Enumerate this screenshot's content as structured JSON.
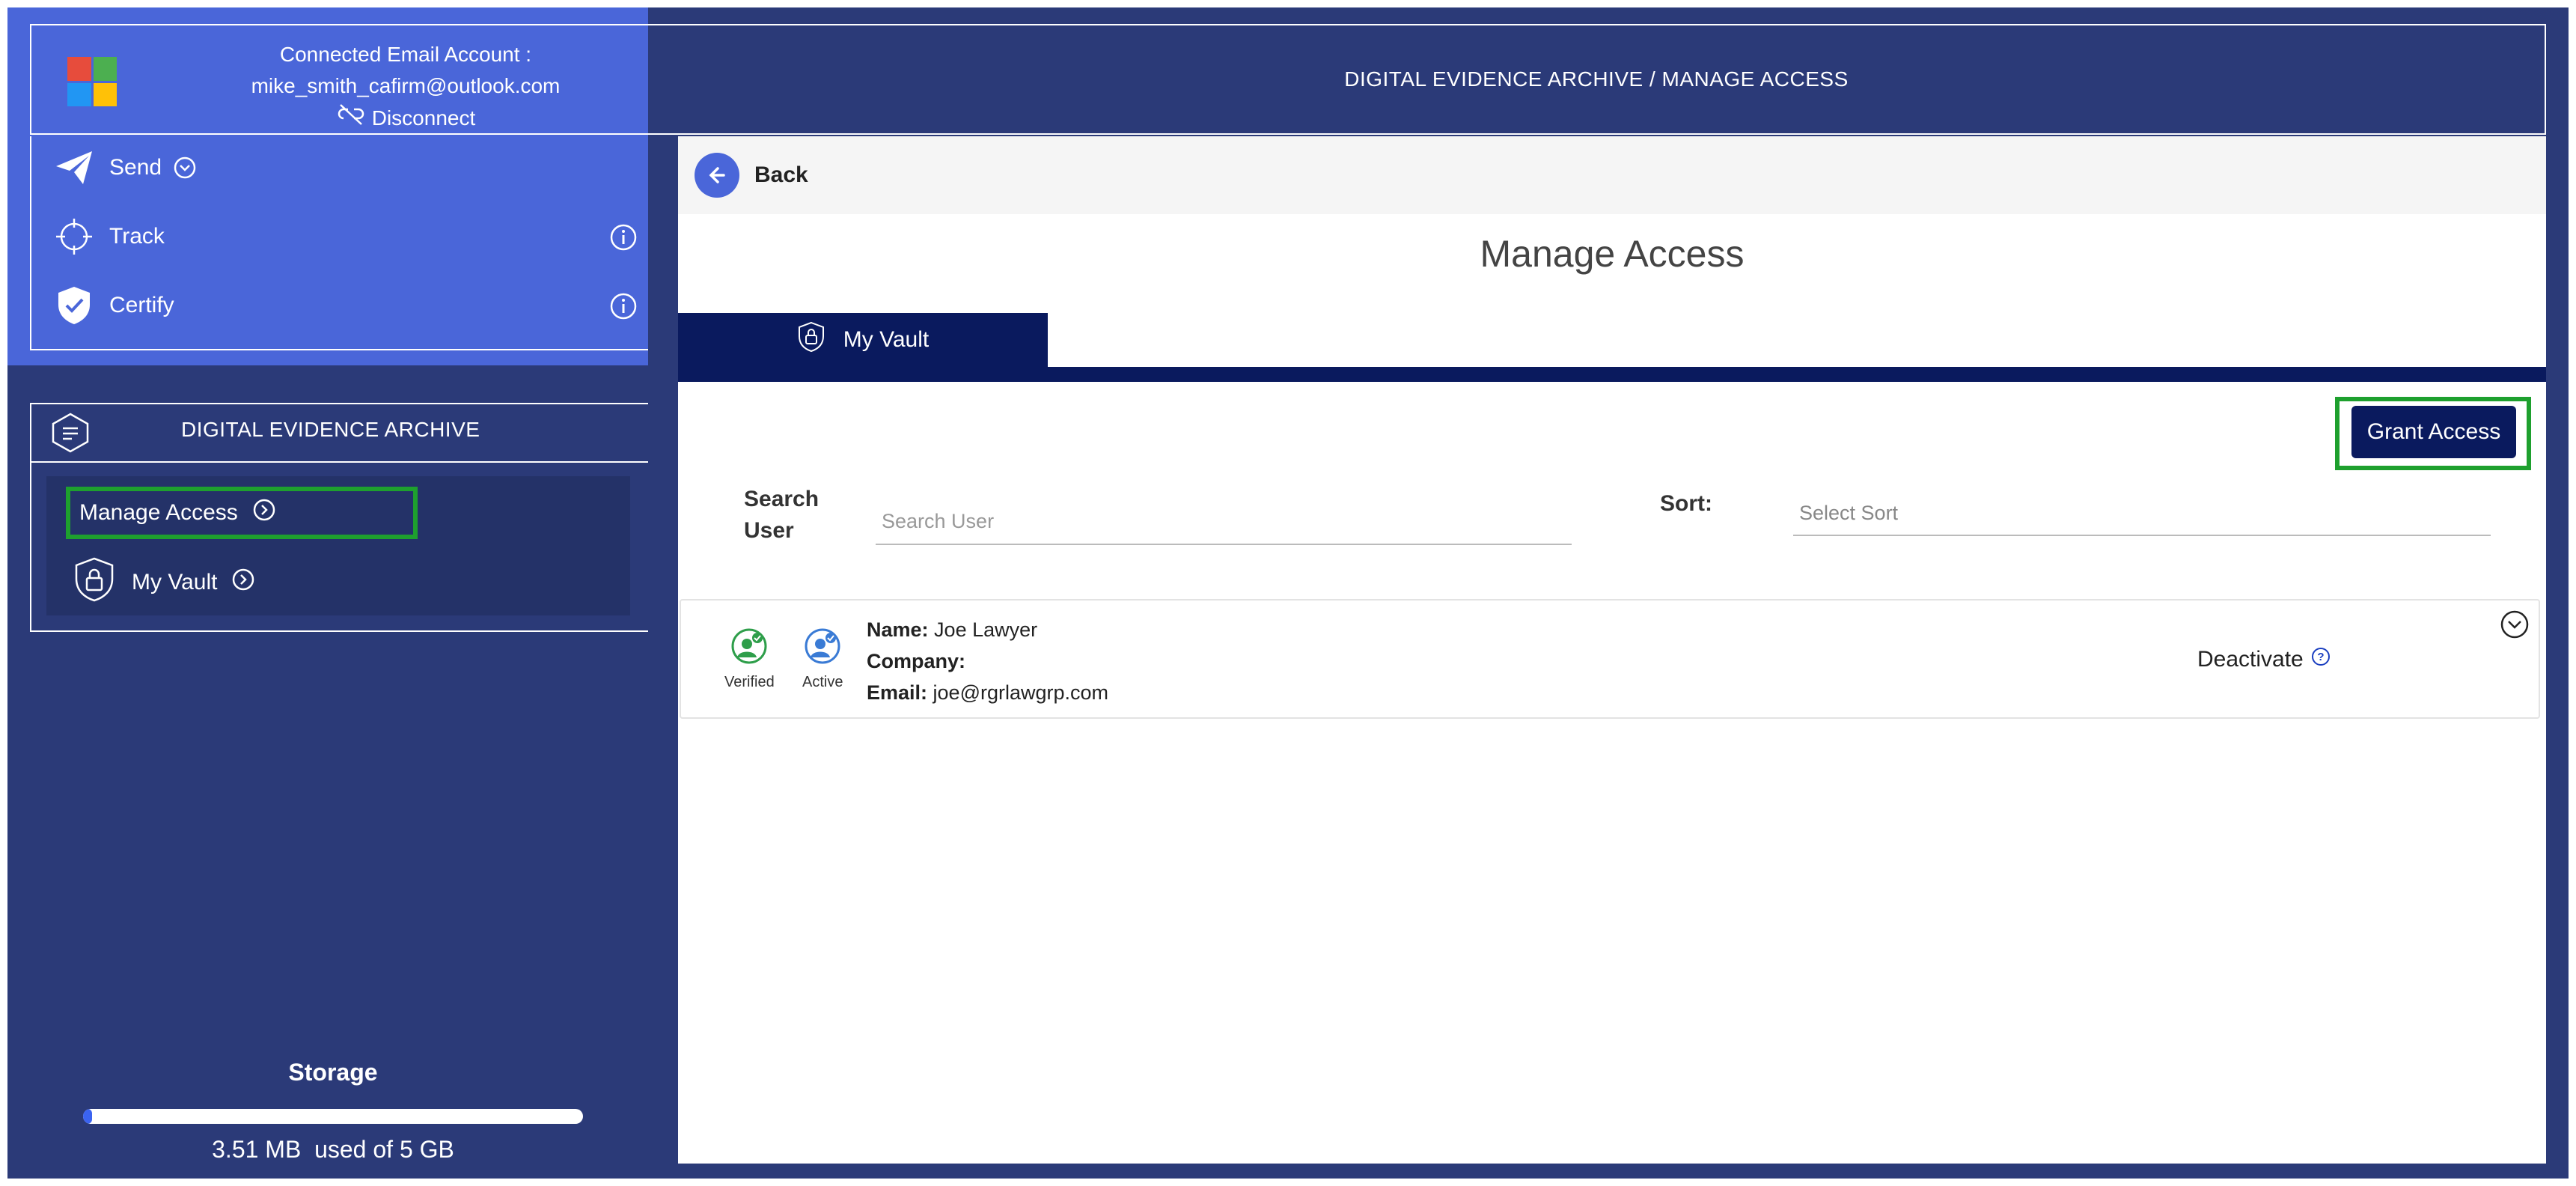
{
  "account": {
    "label": "Connected Email Account :",
    "email": "mike_smith_cafirm@outlook.com",
    "disconnect": "Disconnect",
    "logo_colors": [
      "#e74c3c",
      "#4caf50",
      "#2196f3",
      "#ffc107"
    ]
  },
  "nav": {
    "send": "Send",
    "track": "Track",
    "certify": "Certify"
  },
  "archive": {
    "title": "DIGITAL EVIDENCE ARCHIVE",
    "items": {
      "manage_access": "Manage Access",
      "my_vault": "My Vault"
    }
  },
  "storage": {
    "label": "Storage",
    "used": "3.51 MB",
    "of_label": "used of 5 GB",
    "fraction_used": 0.0007
  },
  "header": {
    "title": "DIGITAL EVIDENCE ARCHIVE / MANAGE ACCESS"
  },
  "main": {
    "back": "Back",
    "page_title": "Manage Access",
    "tab": "My Vault",
    "grant_button": "Grant Access",
    "search": {
      "label_line1": "Search",
      "label_line2": "User",
      "placeholder": "Search User"
    },
    "sort": {
      "label": "Sort:",
      "placeholder": "Select Sort"
    }
  },
  "users": [
    {
      "badges": {
        "verified": "Verified",
        "active": "Active"
      },
      "name_label": "Name:",
      "name": "Joe Lawyer",
      "company_label": "Company:",
      "company": "",
      "email_label": "Email:",
      "email": "joe@rgrlawgrp.com",
      "deactivate": "Deactivate"
    }
  ],
  "colors": {
    "sidebar_dark": "#2b3a78",
    "sidebar_light": "#4a66d9",
    "navy": "#0a1a5e",
    "highlight_green": "#1ea02e"
  }
}
